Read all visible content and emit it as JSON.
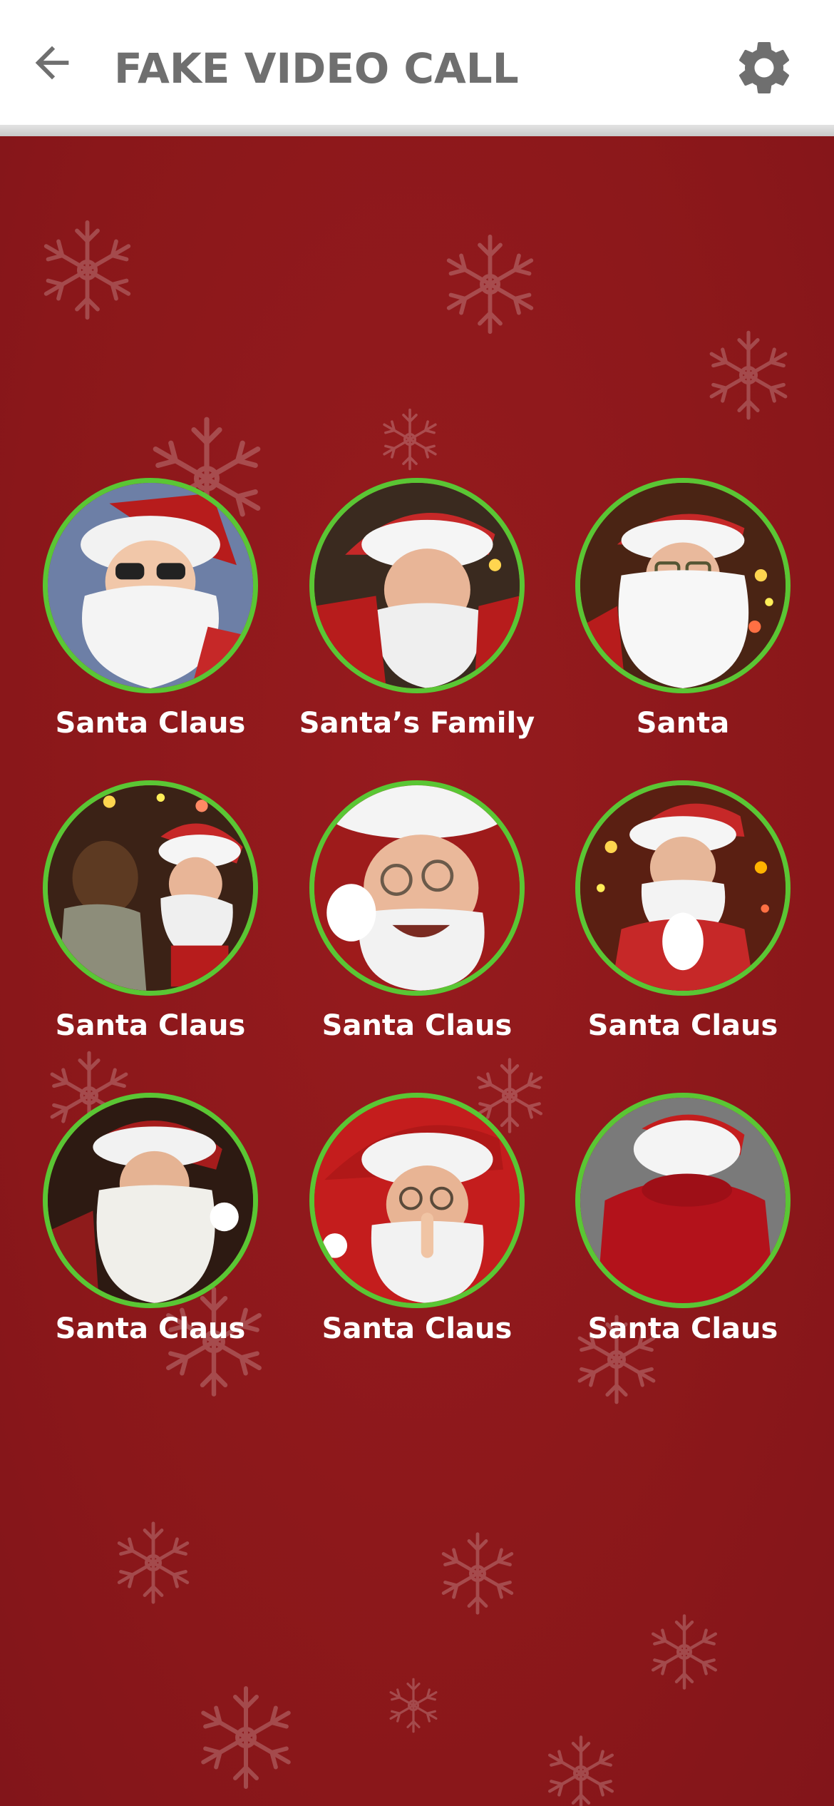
{
  "header": {
    "title": "FAKE VIDEO CALL",
    "back_icon": "arrow-left-icon",
    "settings_icon": "gear-icon"
  },
  "colors": {
    "background": "#8c181a",
    "ring": "#5ac634",
    "header_text": "#6f6f6f"
  },
  "contacts": [
    {
      "name": "Santa Claus",
      "photo": "santa-sunglasses"
    },
    {
      "name": "Santa’s Family",
      "photo": "santa-smiling"
    },
    {
      "name": "Santa",
      "photo": "santa-glasses-beard"
    },
    {
      "name": "Santa Claus",
      "photo": "santa-with-child"
    },
    {
      "name": "Santa Claus",
      "photo": "santa-laughing"
    },
    {
      "name": "Santa Claus",
      "photo": "santa-praying-hands"
    },
    {
      "name": "Santa Claus",
      "photo": "santa-reading"
    },
    {
      "name": "Santa Claus",
      "photo": "santa-shushing"
    },
    {
      "name": "Santa Claus",
      "photo": "santa-from-behind"
    }
  ]
}
